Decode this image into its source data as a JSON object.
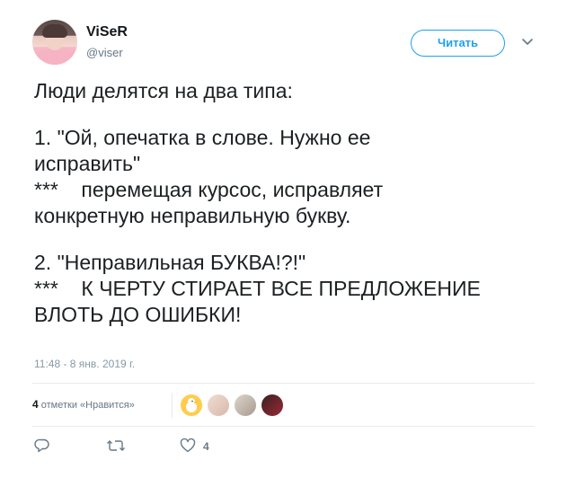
{
  "author": {
    "name": "ViSeR",
    "handle": "@viser"
  },
  "follow_button": {
    "label": "Читать"
  },
  "menu": {
    "icon": "chevron-down-icon"
  },
  "tweet": {
    "paragraphs": [
      [
        "Люди делятся на два типа:"
      ],
      [
        "1. \"Ой, опечатка в слове. Нужно ее",
        "исправить\"",
        "***    перемещая курсос, исправляет",
        "конкретную неправильную букву."
      ],
      [
        "2. \"Неправильная БУКВА!?!\"",
        "***    К ЧЕРТУ СТИРАЕТ ВСЕ ПРЕДЛОЖЕНИЕ",
        "ВЛОТЬ ДО ОШИБКИ!"
      ]
    ],
    "timestamp": "11:48 - 8 янв. 2019 г."
  },
  "stats": {
    "likes_count": "4",
    "likes_label": "отметки «Нравится»"
  },
  "actions": {
    "reply_icon": "reply-icon",
    "retweet_icon": "retweet-icon",
    "like_icon": "heart-icon",
    "like_count": "4"
  },
  "colors": {
    "accent": "#1da1f2",
    "text": "#1c2022",
    "muted": "#657786",
    "timestamp": "#8899a6",
    "divider": "#e6ecf0"
  }
}
